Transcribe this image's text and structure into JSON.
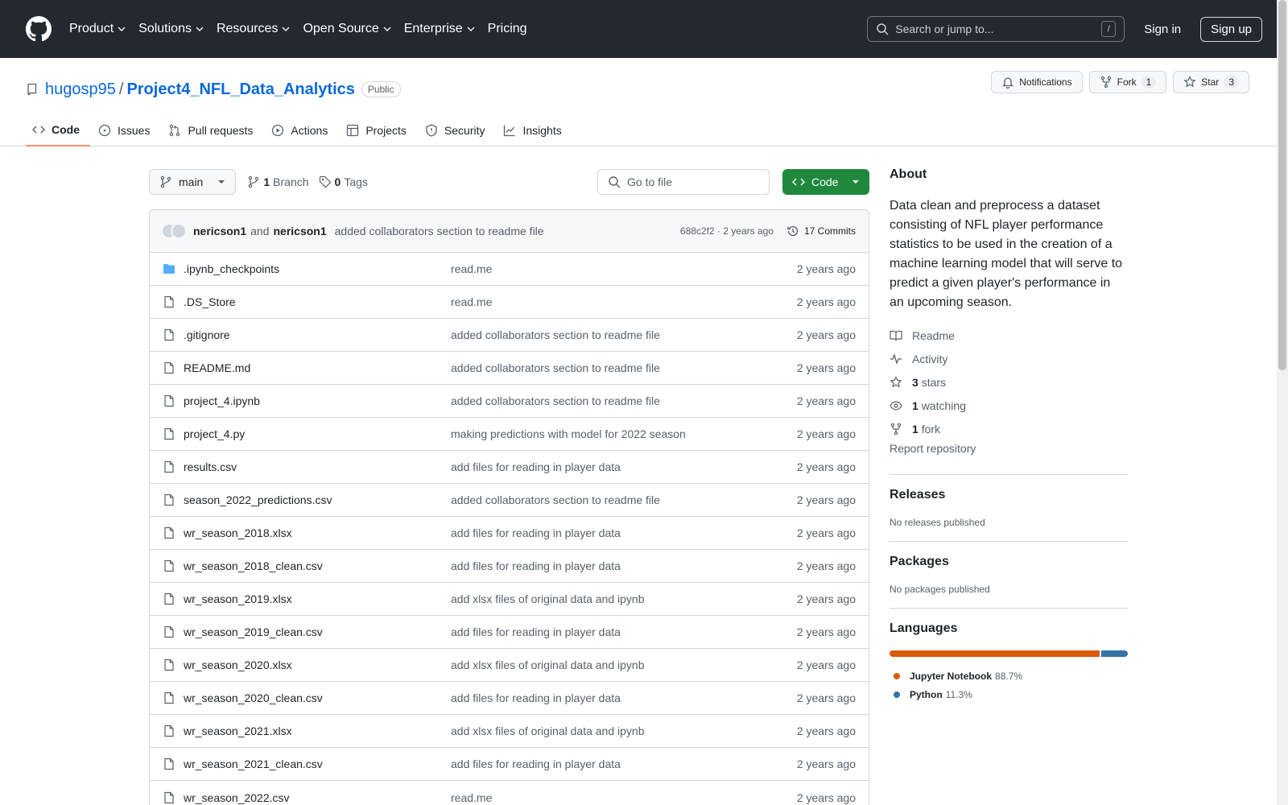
{
  "header": {
    "nav": [
      "Product",
      "Solutions",
      "Resources",
      "Open Source",
      "Enterprise"
    ],
    "pricing": "Pricing",
    "search_placeholder": "Search or jump to...",
    "search_key": "/",
    "sign_in": "Sign in",
    "sign_up": "Sign up"
  },
  "repo": {
    "owner": "hugosp95",
    "separator": "/",
    "name": "Project4_NFL_Data_Analytics",
    "visibility": "Public",
    "notifications": "Notifications",
    "fork_label": "Fork",
    "fork_count": "1",
    "star_label": "Star",
    "star_count": "3"
  },
  "tabs": [
    "Code",
    "Issues",
    "Pull requests",
    "Actions",
    "Projects",
    "Security",
    "Insights"
  ],
  "toolbar": {
    "branch": "main",
    "branch_count": "1",
    "branch_label": "Branch",
    "tag_count": "0",
    "tag_label": "Tags",
    "goto_placeholder": "Go to file",
    "code_button": "Code"
  },
  "commit": {
    "author1": "nericson1",
    "and": "and",
    "author2": "nericson1",
    "message": "added collaborators section to readme file",
    "hash_time": "688c2f2 · 2 years ago",
    "commits": "17 Commits"
  },
  "files": [
    {
      "name": ".ipynb_checkpoints",
      "type": "folder",
      "msg": "read.me",
      "date": "2 years ago"
    },
    {
      "name": ".DS_Store",
      "type": "file",
      "msg": "read.me",
      "date": "2 years ago"
    },
    {
      "name": ".gitignore",
      "type": "file",
      "msg": "added collaborators section to readme file",
      "date": "2 years ago"
    },
    {
      "name": "README.md",
      "type": "file",
      "msg": "added collaborators section to readme file",
      "date": "2 years ago"
    },
    {
      "name": "project_4.ipynb",
      "type": "file",
      "msg": "added collaborators section to readme file",
      "date": "2 years ago"
    },
    {
      "name": "project_4.py",
      "type": "file",
      "msg": "making predictions with model for 2022 season",
      "date": "2 years ago"
    },
    {
      "name": "results.csv",
      "type": "file",
      "msg": "add files for reading in player data",
      "date": "2 years ago"
    },
    {
      "name": "season_2022_predictions.csv",
      "type": "file",
      "msg": "added collaborators section to readme file",
      "date": "2 years ago"
    },
    {
      "name": "wr_season_2018.xlsx",
      "type": "file",
      "msg": "add files for reading in player data",
      "date": "2 years ago"
    },
    {
      "name": "wr_season_2018_clean.csv",
      "type": "file",
      "msg": "add files for reading in player data",
      "date": "2 years ago"
    },
    {
      "name": "wr_season_2019.xlsx",
      "type": "file",
      "msg": "add xlsx files of original data and ipynb",
      "date": "2 years ago"
    },
    {
      "name": "wr_season_2019_clean.csv",
      "type": "file",
      "msg": "add files for reading in player data",
      "date": "2 years ago"
    },
    {
      "name": "wr_season_2020.xlsx",
      "type": "file",
      "msg": "add xlsx files of original data and ipynb",
      "date": "2 years ago"
    },
    {
      "name": "wr_season_2020_clean.csv",
      "type": "file",
      "msg": "add files for reading in player data",
      "date": "2 years ago"
    },
    {
      "name": "wr_season_2021.xlsx",
      "type": "file",
      "msg": "add xlsx files of original data and ipynb",
      "date": "2 years ago"
    },
    {
      "name": "wr_season_2021_clean.csv",
      "type": "file",
      "msg": "add files for reading in player data",
      "date": "2 years ago"
    },
    {
      "name": "wr_season_2022.csv",
      "type": "file",
      "msg": "read.me",
      "date": "2 years ago"
    }
  ],
  "about": {
    "heading": "About",
    "description": "Data clean and preprocess a dataset consisting of NFL player performance statistics to be used in the creation of a machine learning model that will serve to predict a given player's performance in an upcoming season.",
    "readme": "Readme",
    "activity": "Activity",
    "stars_count": "3",
    "stars_label": "stars",
    "watching_count": "1",
    "watching_label": "watching",
    "fork_count": "1",
    "fork_label": "fork",
    "report": "Report repository"
  },
  "releases": {
    "heading": "Releases",
    "empty": "No releases published"
  },
  "packages": {
    "heading": "Packages",
    "empty": "No packages published"
  },
  "languages": {
    "heading": "Languages",
    "items": [
      {
        "name": "Jupyter Notebook",
        "pct": "88.7%",
        "value": 88.7,
        "color": "#DA5B0B"
      },
      {
        "name": "Python",
        "pct": "11.3%",
        "value": 11.3,
        "color": "#3572A5"
      }
    ]
  }
}
